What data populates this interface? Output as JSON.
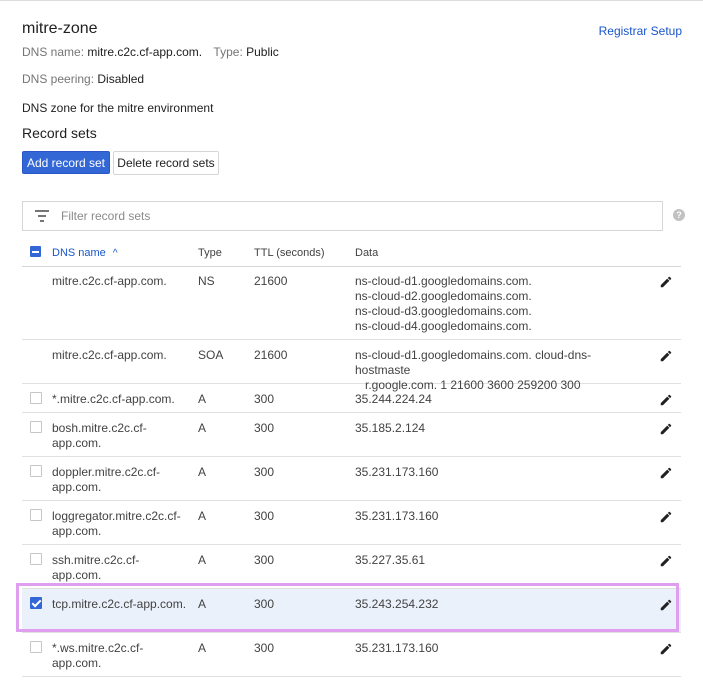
{
  "zone": {
    "title": "mitre-zone",
    "registrar_link": "Registrar Setup",
    "dns_name_label": "DNS name:",
    "dns_name_value": "mitre.c2c.cf-app.com.",
    "type_label": "Type:",
    "type_value": "Public",
    "peering_label": "DNS peering:",
    "peering_value": "Disabled",
    "description": "DNS zone for the mitre environment"
  },
  "record_sets": {
    "heading": "Record sets",
    "add_button": "Add record set",
    "delete_button": "Delete record sets",
    "filter_placeholder": "Filter record sets",
    "help_icon": "?"
  },
  "table": {
    "columns": {
      "name": "DNS name",
      "sort_indicator": "^",
      "type": "Type",
      "ttl": "TTL (seconds)",
      "data": "Data"
    },
    "rows": [
      {
        "name": "mitre.c2c.cf-app.com.",
        "type": "NS",
        "ttl": "21600",
        "data": [
          "ns-cloud-d1.googledomains.com.",
          "ns-cloud-d2.googledomains.com.",
          "ns-cloud-d3.googledomains.com.",
          "ns-cloud-d4.googledomains.com."
        ],
        "checkbox": false,
        "checked": false
      },
      {
        "name": "mitre.c2c.cf-app.com.",
        "type": "SOA",
        "ttl": "21600",
        "data": [
          "ns-cloud-d1.googledomains.com. cloud-dns-hostmaste",
          "r.google.com. 1 21600 3600 259200 300"
        ],
        "checkbox": false,
        "checked": false
      },
      {
        "name": "*.mitre.c2c.cf-app.com.",
        "type": "A",
        "ttl": "300",
        "data": [
          "35.244.224.24"
        ],
        "checkbox": true,
        "checked": false
      },
      {
        "name": "bosh.mitre.c2c.cf-app.com.",
        "type": "A",
        "ttl": "300",
        "data": [
          "35.185.2.124"
        ],
        "checkbox": true,
        "checked": false
      },
      {
        "name": "doppler.mitre.c2c.cf-app.com.",
        "type": "A",
        "ttl": "300",
        "data": [
          "35.231.173.160"
        ],
        "checkbox": true,
        "checked": false
      },
      {
        "name": "loggregator.mitre.c2c.cf-app.com.",
        "type": "A",
        "ttl": "300",
        "data": [
          "35.231.173.160"
        ],
        "checkbox": true,
        "checked": false
      },
      {
        "name": "ssh.mitre.c2c.cf-app.com.",
        "type": "A",
        "ttl": "300",
        "data": [
          "35.227.35.61"
        ],
        "checkbox": true,
        "checked": false
      },
      {
        "name": "tcp.mitre.c2c.cf-app.com.",
        "type": "A",
        "ttl": "300",
        "data": [
          "35.243.254.232"
        ],
        "checkbox": true,
        "checked": true
      },
      {
        "name": "*.ws.mitre.c2c.cf-app.com.",
        "type": "A",
        "ttl": "300",
        "data": [
          "35.231.173.160"
        ],
        "checkbox": true,
        "checked": false
      }
    ]
  },
  "colors": {
    "accent": "#3367d6",
    "link": "#1a56c9",
    "selected_row": "#eaf1fb",
    "highlight_border": "#e09ef0"
  }
}
